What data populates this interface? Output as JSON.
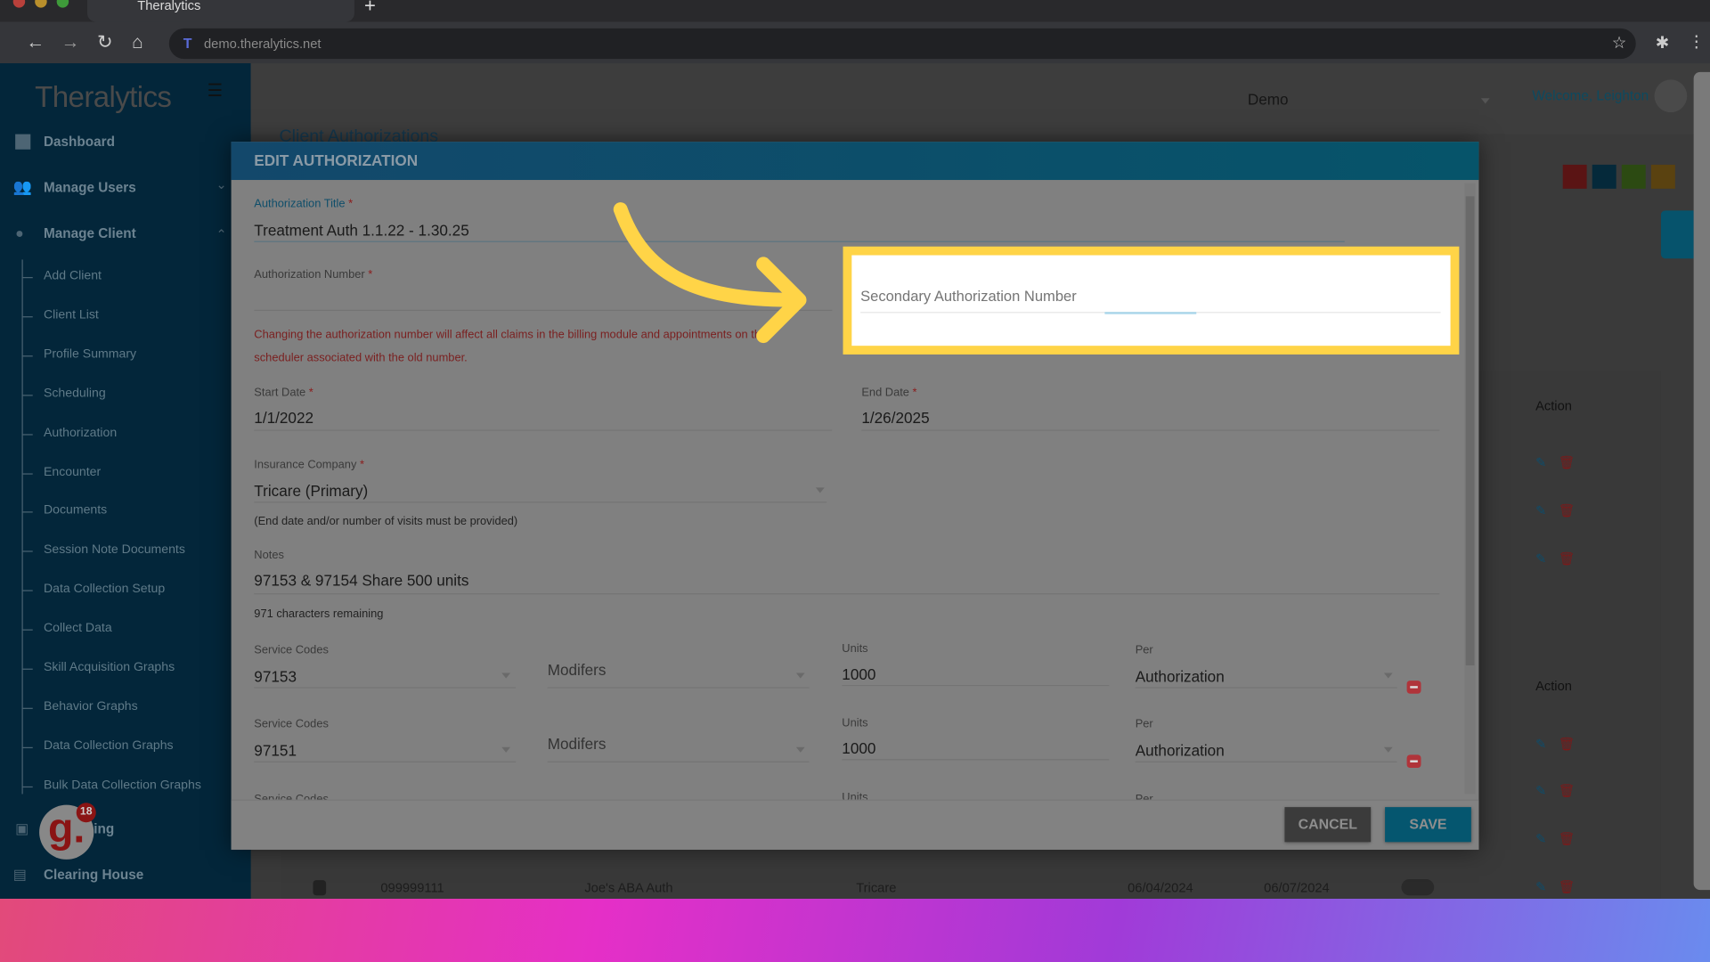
{
  "browser": {
    "tab_title": "Theralytics",
    "url": "demo.theralytics.net"
  },
  "sidebar": {
    "logo": "Theralytics",
    "items": [
      {
        "label": "Dashboard"
      },
      {
        "label": "Manage Users"
      },
      {
        "label": "Manage Client"
      }
    ],
    "sub_items": [
      "Add Client",
      "Client List",
      "Profile Summary",
      "Scheduling",
      "Authorization",
      "Encounter",
      "Documents",
      "Session Note Documents",
      "Data Collection Setup",
      "Collect Data",
      "Skill Acquisition Graphs",
      "Behavior Graphs",
      "Data Collection Graphs",
      "Bulk Data Collection Graphs"
    ],
    "billing_partial": "ing",
    "clearing_house": "Clearing House",
    "notification_count": "18"
  },
  "header": {
    "org_select": "Demo",
    "welcome": "Welcome, Leighton",
    "page_title": "Client Authorizations"
  },
  "background_table": {
    "action_header": "Action",
    "last_row": {
      "number": "099999111",
      "title": "Joe's ABA Auth",
      "insurance": "Tricare",
      "start": "06/04/2024",
      "end": "06/07/2024"
    }
  },
  "modal": {
    "title": "EDIT AUTHORIZATION",
    "auth_title_label": "Authorization Title",
    "auth_title_value": "Treatment Auth 1.1.22 - 1.30.25",
    "auth_number_label": "Authorization Number",
    "auth_number_value": "",
    "secondary_placeholder": "Secondary Authorization Number",
    "warning": "Changing the authorization number will affect all claims in the billing module and appointments on the scheduler associated with the old number.",
    "start_date_label": "Start Date",
    "start_date": "1/1/2022",
    "end_date_label": "End Date",
    "end_date": "1/26/2025",
    "insurance_label": "Insurance Company",
    "insurance": "Tricare (Primary)",
    "insurance_hint": "(End date and/or number of visits must be provided)",
    "notes_label": "Notes",
    "notes": "97153 & 97154 Share 500 units",
    "chars_remaining": "971 characters remaining",
    "service_rows": [
      {
        "code_label": "Service Codes",
        "code": "97153",
        "modifiers": "Modifers",
        "units_label": "Units",
        "units": "1000",
        "per_label": "Per",
        "per": "Authorization"
      },
      {
        "code_label": "Service Codes",
        "code": "97151",
        "modifiers": "Modifers",
        "units_label": "Units",
        "units": "1000",
        "per_label": "Per",
        "per": "Authorization"
      }
    ],
    "partial_row": {
      "code_label": "Service Codes",
      "units_label": "Units",
      "per_label": "Per"
    },
    "cancel": "CANCEL",
    "save": "SAVE",
    "required_mark": "*"
  },
  "colors": {
    "highlight": "#ffd447",
    "modal_header": "#13486b",
    "save": "#05566f",
    "arrow": "#ffd447"
  }
}
